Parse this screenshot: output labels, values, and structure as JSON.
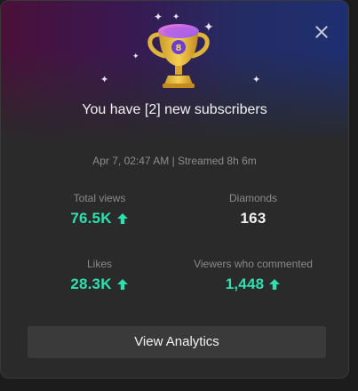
{
  "header": {
    "title": "You have [2] new subscribers"
  },
  "stream_info": "Apr 7, 02:47 AM | Streamed 8h 6m",
  "stats": {
    "total_views": {
      "label": "Total views",
      "value": "76.5K",
      "trend": "up"
    },
    "diamonds": {
      "label": "Diamonds",
      "value": "163"
    },
    "likes": {
      "label": "Likes",
      "value": "28.3K",
      "trend": "up"
    },
    "viewers_commented": {
      "label": "Viewers who commented",
      "value": "1,448",
      "trend": "up"
    }
  },
  "actions": {
    "view_analytics_label": "View Analytics"
  },
  "icons": {
    "close": "close-icon",
    "trophy": "trophy-icon",
    "trend_up": "arrow-up-icon"
  },
  "colors": {
    "accent_green": "#2ee0b0",
    "card_background": "#2a2a2a",
    "button_background": "#3a3a3a"
  }
}
